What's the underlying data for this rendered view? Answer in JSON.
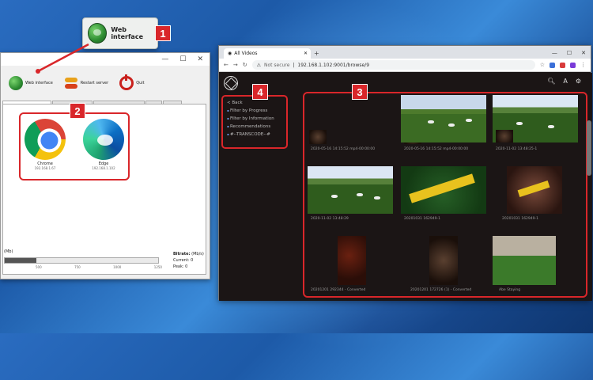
{
  "callout": {
    "label": "Web interface",
    "badge": "1"
  },
  "app": {
    "toolbar": {
      "web": "Web interface",
      "restart": "Restart server",
      "quit": "Quit"
    },
    "tabs": [
      "Navigation Settings",
      "Shared Content",
      "Transcoding Settings",
      "Help",
      "About"
    ],
    "badge": "2",
    "devices": [
      {
        "name": "Chrome",
        "ip": "192.168.1.67"
      },
      {
        "name": "Edge",
        "ip": "192.168.1.102"
      }
    ],
    "bitrate_unit": "(Mb)",
    "ticks": [
      "500",
      "750",
      "1000",
      "1250"
    ],
    "bitrate_label": "Bitrate:",
    "bitrate_unit2": "(Mb/s)",
    "current_label": "Current:",
    "current_value": "0",
    "peak_label": "Peak:",
    "peak_value": "0"
  },
  "browser": {
    "tab_title": "All Videos",
    "not_secure": "Not secure",
    "url": "192.168.1.102:9001/browse/9",
    "badge_nav": "4",
    "badge_grid": "3",
    "nav": {
      "back": "< Back",
      "items": [
        "Filter by Progress",
        "Filter by Information",
        "Recommendations",
        "#--TRANSCODE--#"
      ]
    },
    "videos": [
      {
        "caption": "2020-05-16 14:15:52 mp4-00:00:00"
      },
      {
        "caption": "2020-05-16 14:15:52 mp4-00:00:00"
      },
      {
        "caption": "2020-11-02 13:48:25-1"
      },
      {
        "caption": "2020-11-02 13:48:29"
      },
      {
        "caption": "20201031 162949-1"
      },
      {
        "caption": "20201031 162949-1"
      },
      {
        "caption": "20201201 292344 - Converted"
      },
      {
        "caption": "20201201 172726 (1) - Converted"
      },
      {
        "caption": "Abe Staying"
      }
    ]
  }
}
